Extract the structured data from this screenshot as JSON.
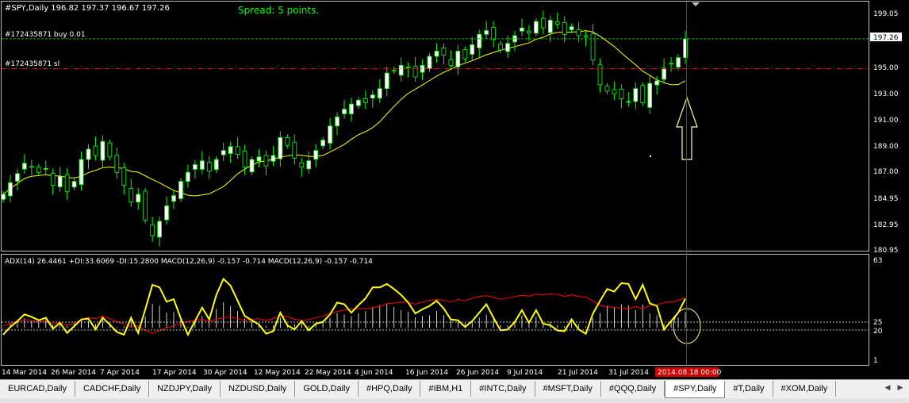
{
  "header": {
    "symbol_info": "#SPY,Daily  196.82 197.37 196.67 197.26",
    "spread": "Spread: 5 points."
  },
  "order_lines": [
    {
      "label": "#172435871 buy 0.01",
      "price": 197.26,
      "color": "#00c000"
    },
    {
      "label": "#172435871 sl",
      "price": 194.95,
      "color": "#ff0000"
    }
  ],
  "price_axis": {
    "ticks": [
      "199.05",
      "197.26",
      "195.00",
      "193.00",
      "191.00",
      "189.00",
      "187.00",
      "184.95",
      "182.95",
      "180.95"
    ],
    "current_price_label": "197.26"
  },
  "indicator": {
    "label": "ADX(14) 26.4461 +DI:33.6069 -DI:15.2800  MACD(12,26,9) -0.157 -0.714  MACD(12,26,9) -0.157 -0.714",
    "axis_ticks": [
      "63",
      "25",
      "20",
      "1"
    ]
  },
  "time_axis": {
    "labels": [
      "14 Mar 2014",
      "26 Mar 2014",
      "7 Apr 2014",
      "17 Apr 2014",
      "30 Apr 2014",
      "12 May 2014",
      "22 May 2014",
      "4 Jun 2014",
      "16 Jun 2014",
      "26 Jun 2014",
      "9 Jul 2014",
      "21 Jul 2014",
      "31 Jul 2014"
    ],
    "cursor_label": "2014.08.18 00:00"
  },
  "tabs": [
    {
      "label": "EURCAD,Daily",
      "active": false
    },
    {
      "label": "CADCHF,Daily",
      "active": false
    },
    {
      "label": "NZDJPY,Daily",
      "active": false
    },
    {
      "label": "NZDUSD,Daily",
      "active": false
    },
    {
      "label": "GOLD,Daily",
      "active": false
    },
    {
      "label": "#HPQ,Daily",
      "active": false
    },
    {
      "label": "#IBM,H1",
      "active": false
    },
    {
      "label": "#INTC,Daily",
      "active": false
    },
    {
      "label": "#MSFT,Daily",
      "active": false
    },
    {
      "label": "#QQQ,Daily",
      "active": false
    },
    {
      "label": "#SPY,Daily",
      "active": true
    },
    {
      "label": "#T,Daily",
      "active": false
    },
    {
      "label": "#XOM,Daily",
      "active": false
    }
  ],
  "colors": {
    "bull_candle": "#ffffff",
    "bear_candle": "#000000",
    "candle_outline": "#00ff00",
    "moving_average": "#ffff00",
    "adx_line": "#ffff00",
    "signal_line": "#ff0000",
    "cursor_line": "#ff0000",
    "arrow": "#ffff80",
    "spread_text": "#00ff00"
  },
  "chart_data": {
    "type": "candlestick",
    "close_series": [
      185.2,
      186.1,
      186.8,
      187.6,
      187.3,
      186.9,
      187.2,
      185.9,
      186.6,
      185.4,
      186.2,
      187.9,
      188.7,
      188.2,
      189.3,
      188.1,
      186.9,
      185.9,
      184.6,
      185.2,
      183.2,
      182.0,
      183.1,
      184.3,
      185.1,
      186.2,
      186.9,
      187.5,
      187.8,
      187.0,
      187.9,
      188.6,
      188.9,
      188.3,
      187.3,
      187.9,
      188.1,
      187.4,
      188.2,
      189.6,
      189.0,
      188.0,
      187.3,
      187.8,
      188.6,
      189.4,
      190.5,
      191.2,
      191.8,
      192.2,
      192.5,
      192.3,
      192.9,
      193.4,
      194.6,
      194.8,
      195.2,
      195.0,
      194.3,
      195.2,
      195.9,
      196.3,
      196.0,
      195.2,
      196.3,
      195.7,
      196.8,
      197.6,
      197.9,
      197.2,
      196.4,
      196.9,
      197.5,
      198.1,
      197.7,
      198.6,
      198.1,
      198.7,
      198.4,
      197.6,
      198.2,
      197.5,
      197.4,
      195.6,
      193.7,
      193.2,
      193.0,
      192.6,
      192.4,
      193.4,
      192.3,
      193.8,
      194.0,
      195.0,
      195.3,
      195.8,
      197.26
    ],
    "price_range": [
      180.95,
      199.9
    ]
  }
}
